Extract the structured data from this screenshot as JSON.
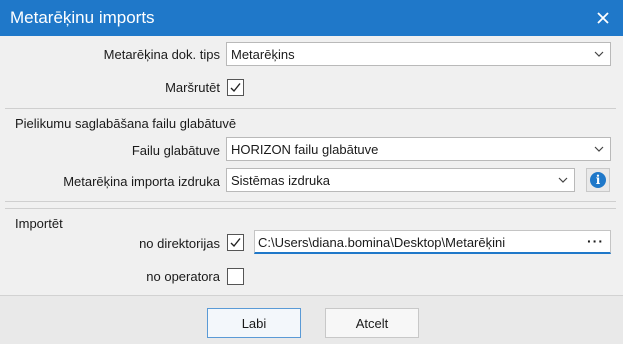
{
  "window": {
    "title": "Metarēķinu imports",
    "close_icon": "close-icon"
  },
  "general": {
    "doc_type_label": "Metarēķina dok. tips",
    "doc_type_value": "Metarēķins",
    "route_label": "Maršrutēt",
    "route_checked": true
  },
  "attachments": {
    "section_title": "Pielikumu saglabāšana failu glabātuvē",
    "storage_label": "Failu glabātuve",
    "storage_value": "HORIZON failu glabātuve",
    "print_label": "Metarēķina importa izdruka",
    "print_value": "Sistēmas izdruka",
    "info_icon": "info-icon"
  },
  "import": {
    "section_title": "Importēt",
    "dir_label": "no direktorijas",
    "dir_checked": true,
    "dir_path": "C:\\Users\\diana.bomina\\Desktop\\Metarēķini",
    "browse_label": "···",
    "operator_label": "no operatora",
    "operator_checked": false
  },
  "buttons": {
    "ok_label": "Labi",
    "cancel_label": "Atcelt"
  },
  "colors": {
    "accent": "#1f78c9",
    "panel_bg": "#f0f0f0"
  }
}
